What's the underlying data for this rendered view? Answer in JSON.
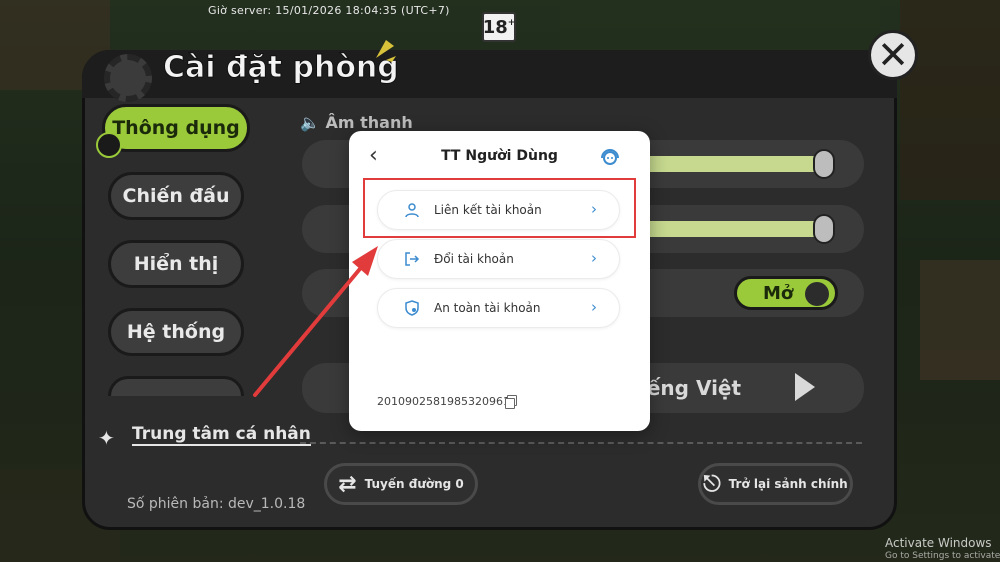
{
  "server_time": "Giờ server:  15/01/2026 18:04:35  (UTC+7)",
  "age_rating": {
    "value": "18",
    "plus": "+"
  },
  "settings": {
    "title": "Cài đặt phòng",
    "tabs": [
      {
        "label": "Thông dụng",
        "active": true
      },
      {
        "label": "Chiến đấu",
        "active": false
      },
      {
        "label": "Hiển thị",
        "active": false
      },
      {
        "label": "Hệ thống",
        "active": false
      }
    ],
    "sound_section": "Âm thanh",
    "volume_levels": [
      0.92,
      0.92
    ],
    "toggle_label": "Mở",
    "language_value": "iếng Việt",
    "personal_center": "Trung tâm cá nhân",
    "version": "Số phiên bản: dev_1.0.18",
    "route_button": "Tuyến đường 0",
    "lobby_button": "Trở lại sảnh chính"
  },
  "modal": {
    "title": "TT Người Dùng",
    "items": [
      {
        "label": "Liên kết tài khoản",
        "icon": "user-icon"
      },
      {
        "label": "Đổi tài khoản",
        "icon": "switch-account-icon"
      },
      {
        "label": "An toàn tài khoản",
        "icon": "shield-icon"
      }
    ],
    "uid": "2010902581985320961"
  },
  "colors": {
    "accent_green": "#9ac93a",
    "link_blue": "#3c8ccf",
    "highlight_red": "#e23b3b"
  },
  "watermark": {
    "title": "Activate Windows",
    "subtitle": "Go to Settings to activate Windows."
  }
}
